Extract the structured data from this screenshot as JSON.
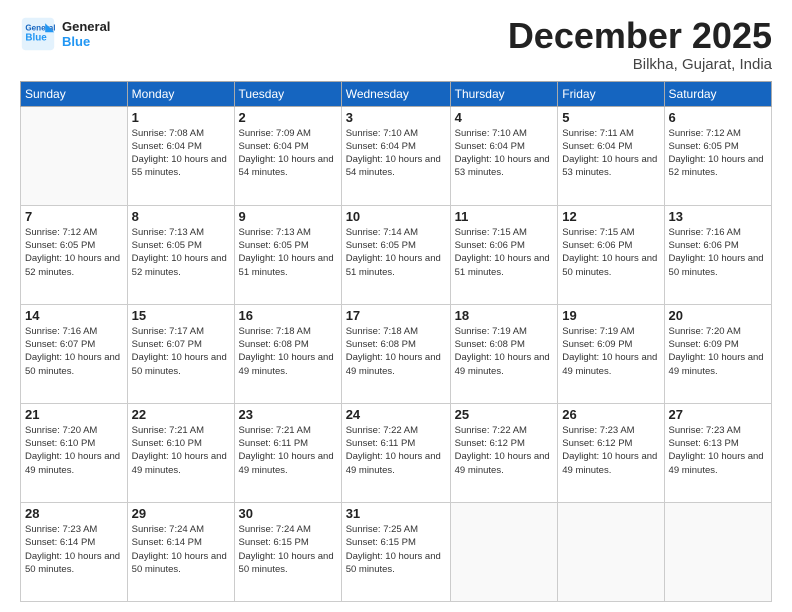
{
  "header": {
    "logo_line1": "General",
    "logo_line2": "Blue",
    "month_title": "December 2025",
    "location": "Bilkha, Gujarat, India"
  },
  "weekdays": [
    "Sunday",
    "Monday",
    "Tuesday",
    "Wednesday",
    "Thursday",
    "Friday",
    "Saturday"
  ],
  "weeks": [
    [
      {
        "day": null,
        "info": null
      },
      {
        "day": "1",
        "info": "Sunrise: 7:08 AM\nSunset: 6:04 PM\nDaylight: 10 hours\nand 55 minutes."
      },
      {
        "day": "2",
        "info": "Sunrise: 7:09 AM\nSunset: 6:04 PM\nDaylight: 10 hours\nand 54 minutes."
      },
      {
        "day": "3",
        "info": "Sunrise: 7:10 AM\nSunset: 6:04 PM\nDaylight: 10 hours\nand 54 minutes."
      },
      {
        "day": "4",
        "info": "Sunrise: 7:10 AM\nSunset: 6:04 PM\nDaylight: 10 hours\nand 53 minutes."
      },
      {
        "day": "5",
        "info": "Sunrise: 7:11 AM\nSunset: 6:04 PM\nDaylight: 10 hours\nand 53 minutes."
      },
      {
        "day": "6",
        "info": "Sunrise: 7:12 AM\nSunset: 6:05 PM\nDaylight: 10 hours\nand 52 minutes."
      }
    ],
    [
      {
        "day": "7",
        "info": "Sunrise: 7:12 AM\nSunset: 6:05 PM\nDaylight: 10 hours\nand 52 minutes."
      },
      {
        "day": "8",
        "info": "Sunrise: 7:13 AM\nSunset: 6:05 PM\nDaylight: 10 hours\nand 52 minutes."
      },
      {
        "day": "9",
        "info": "Sunrise: 7:13 AM\nSunset: 6:05 PM\nDaylight: 10 hours\nand 51 minutes."
      },
      {
        "day": "10",
        "info": "Sunrise: 7:14 AM\nSunset: 6:05 PM\nDaylight: 10 hours\nand 51 minutes."
      },
      {
        "day": "11",
        "info": "Sunrise: 7:15 AM\nSunset: 6:06 PM\nDaylight: 10 hours\nand 51 minutes."
      },
      {
        "day": "12",
        "info": "Sunrise: 7:15 AM\nSunset: 6:06 PM\nDaylight: 10 hours\nand 50 minutes."
      },
      {
        "day": "13",
        "info": "Sunrise: 7:16 AM\nSunset: 6:06 PM\nDaylight: 10 hours\nand 50 minutes."
      }
    ],
    [
      {
        "day": "14",
        "info": "Sunrise: 7:16 AM\nSunset: 6:07 PM\nDaylight: 10 hours\nand 50 minutes."
      },
      {
        "day": "15",
        "info": "Sunrise: 7:17 AM\nSunset: 6:07 PM\nDaylight: 10 hours\nand 50 minutes."
      },
      {
        "day": "16",
        "info": "Sunrise: 7:18 AM\nSunset: 6:08 PM\nDaylight: 10 hours\nand 49 minutes."
      },
      {
        "day": "17",
        "info": "Sunrise: 7:18 AM\nSunset: 6:08 PM\nDaylight: 10 hours\nand 49 minutes."
      },
      {
        "day": "18",
        "info": "Sunrise: 7:19 AM\nSunset: 6:08 PM\nDaylight: 10 hours\nand 49 minutes."
      },
      {
        "day": "19",
        "info": "Sunrise: 7:19 AM\nSunset: 6:09 PM\nDaylight: 10 hours\nand 49 minutes."
      },
      {
        "day": "20",
        "info": "Sunrise: 7:20 AM\nSunset: 6:09 PM\nDaylight: 10 hours\nand 49 minutes."
      }
    ],
    [
      {
        "day": "21",
        "info": "Sunrise: 7:20 AM\nSunset: 6:10 PM\nDaylight: 10 hours\nand 49 minutes."
      },
      {
        "day": "22",
        "info": "Sunrise: 7:21 AM\nSunset: 6:10 PM\nDaylight: 10 hours\nand 49 minutes."
      },
      {
        "day": "23",
        "info": "Sunrise: 7:21 AM\nSunset: 6:11 PM\nDaylight: 10 hours\nand 49 minutes."
      },
      {
        "day": "24",
        "info": "Sunrise: 7:22 AM\nSunset: 6:11 PM\nDaylight: 10 hours\nand 49 minutes."
      },
      {
        "day": "25",
        "info": "Sunrise: 7:22 AM\nSunset: 6:12 PM\nDaylight: 10 hours\nand 49 minutes."
      },
      {
        "day": "26",
        "info": "Sunrise: 7:23 AM\nSunset: 6:12 PM\nDaylight: 10 hours\nand 49 minutes."
      },
      {
        "day": "27",
        "info": "Sunrise: 7:23 AM\nSunset: 6:13 PM\nDaylight: 10 hours\nand 49 minutes."
      }
    ],
    [
      {
        "day": "28",
        "info": "Sunrise: 7:23 AM\nSunset: 6:14 PM\nDaylight: 10 hours\nand 50 minutes."
      },
      {
        "day": "29",
        "info": "Sunrise: 7:24 AM\nSunset: 6:14 PM\nDaylight: 10 hours\nand 50 minutes."
      },
      {
        "day": "30",
        "info": "Sunrise: 7:24 AM\nSunset: 6:15 PM\nDaylight: 10 hours\nand 50 minutes."
      },
      {
        "day": "31",
        "info": "Sunrise: 7:25 AM\nSunset: 6:15 PM\nDaylight: 10 hours\nand 50 minutes."
      },
      {
        "day": null,
        "info": null
      },
      {
        "day": null,
        "info": null
      },
      {
        "day": null,
        "info": null
      }
    ]
  ]
}
